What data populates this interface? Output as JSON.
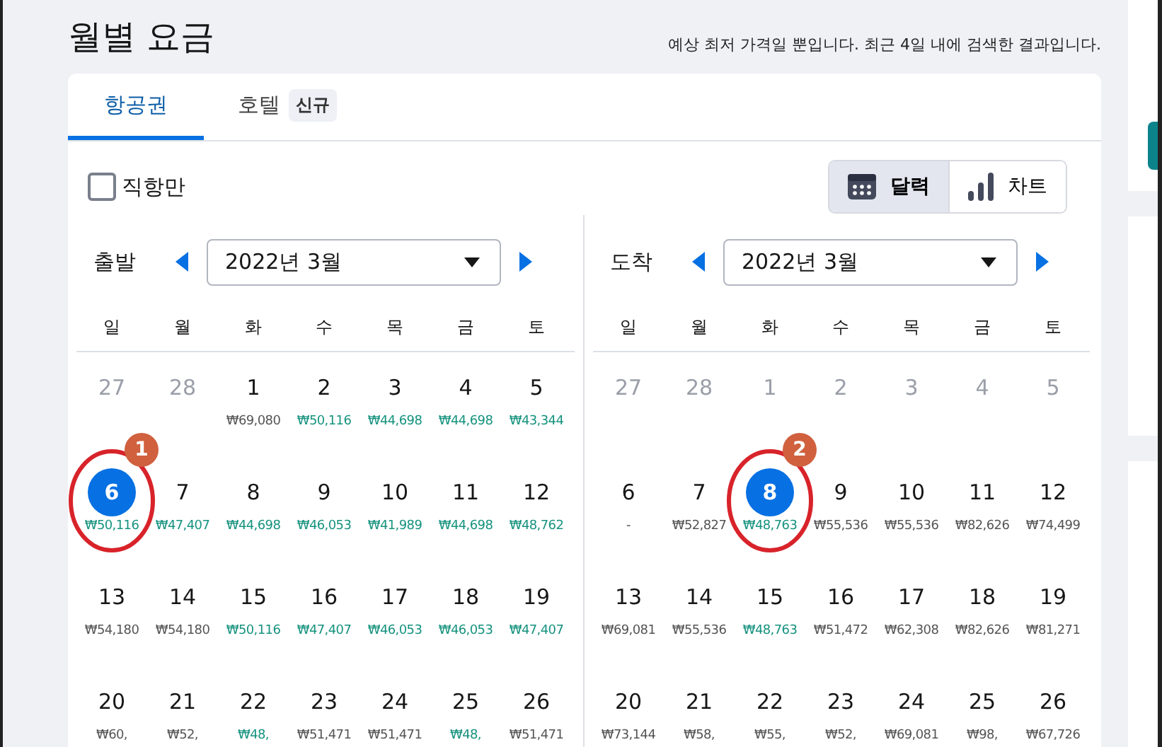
{
  "title": "월별 요금",
  "note": "예상 최저 가격일 뿐입니다. 최근 4일 내에 검색한 결과입니다.",
  "tabs": [
    {
      "label": "항공권",
      "selected": true
    },
    {
      "label": "호텔",
      "badge": "신규",
      "selected": false
    }
  ],
  "direct_only": {
    "label": "직항만",
    "checked": false
  },
  "view_toggle": [
    {
      "label": "달력",
      "kind": "calendar",
      "selected": true
    },
    {
      "label": "차트",
      "kind": "chart",
      "selected": false
    }
  ],
  "calendars": [
    {
      "label": "출발",
      "month": "2022년 3월",
      "weekdays": [
        "일",
        "월",
        "화",
        "수",
        "목",
        "금",
        "토"
      ],
      "weeks": [
        [
          {
            "day": "27",
            "disabled": true,
            "selected": false
          },
          {
            "day": "28",
            "disabled": true,
            "selected": false
          },
          {
            "day": "1",
            "price": "₩69,080",
            "cheap": false,
            "disabled": false,
            "selected": false
          },
          {
            "day": "2",
            "price": "₩50,116",
            "cheap": true,
            "disabled": false,
            "selected": false
          },
          {
            "day": "3",
            "price": "₩44,698",
            "cheap": true,
            "disabled": false,
            "selected": false
          },
          {
            "day": "4",
            "price": "₩44,698",
            "cheap": true,
            "disabled": false,
            "selected": false
          },
          {
            "day": "5",
            "price": "₩43,344",
            "cheap": true,
            "disabled": false,
            "selected": false
          }
        ],
        [
          {
            "day": "6",
            "price": "₩50,116",
            "cheap": true,
            "disabled": false,
            "selected": true,
            "annotation": "1"
          },
          {
            "day": "7",
            "price": "₩47,407",
            "cheap": true,
            "disabled": false,
            "selected": false
          },
          {
            "day": "8",
            "price": "₩44,698",
            "cheap": true,
            "disabled": false,
            "selected": false
          },
          {
            "day": "9",
            "price": "₩46,053",
            "cheap": true,
            "disabled": false,
            "selected": false
          },
          {
            "day": "10",
            "price": "₩41,989",
            "cheap": true,
            "disabled": false,
            "selected": false
          },
          {
            "day": "11",
            "price": "₩44,698",
            "cheap": true,
            "disabled": false,
            "selected": false
          },
          {
            "day": "12",
            "price": "₩48,762",
            "cheap": true,
            "disabled": false,
            "selected": false
          }
        ],
        [
          {
            "day": "13",
            "price": "₩54,180",
            "cheap": false,
            "disabled": false,
            "selected": false
          },
          {
            "day": "14",
            "price": "₩54,180",
            "cheap": false,
            "disabled": false,
            "selected": false
          },
          {
            "day": "15",
            "price": "₩50,116",
            "cheap": true,
            "disabled": false,
            "selected": false
          },
          {
            "day": "16",
            "price": "₩47,407",
            "cheap": true,
            "disabled": false,
            "selected": false
          },
          {
            "day": "17",
            "price": "₩46,053",
            "cheap": true,
            "disabled": false,
            "selected": false
          },
          {
            "day": "18",
            "price": "₩46,053",
            "cheap": true,
            "disabled": false,
            "selected": false
          },
          {
            "day": "19",
            "price": "₩47,407",
            "cheap": true,
            "disabled": false,
            "selected": false
          }
        ],
        [
          {
            "day": "20",
            "price": "₩60,",
            "cheap": false,
            "disabled": false,
            "selected": false
          },
          {
            "day": "21",
            "price": "₩52,",
            "cheap": false,
            "disabled": false,
            "selected": false
          },
          {
            "day": "22",
            "price": "₩48,",
            "cheap": true,
            "disabled": false,
            "selected": false
          },
          {
            "day": "23",
            "price": "₩51,471",
            "cheap": false,
            "disabled": false,
            "selected": false
          },
          {
            "day": "24",
            "price": "₩51,471",
            "cheap": false,
            "disabled": false,
            "selected": false
          },
          {
            "day": "25",
            "price": "₩48,",
            "cheap": true,
            "disabled": false,
            "selected": false
          },
          {
            "day": "26",
            "price": "₩51,471",
            "cheap": false,
            "disabled": false,
            "selected": false
          }
        ]
      ]
    },
    {
      "label": "도착",
      "month": "2022년 3월",
      "weekdays": [
        "일",
        "월",
        "화",
        "수",
        "목",
        "금",
        "토"
      ],
      "weeks": [
        [
          {
            "day": "27",
            "disabled": true,
            "selected": false
          },
          {
            "day": "28",
            "disabled": true,
            "selected": false
          },
          {
            "day": "1",
            "disabled": true,
            "selected": false
          },
          {
            "day": "2",
            "disabled": true,
            "selected": false
          },
          {
            "day": "3",
            "disabled": true,
            "selected": false
          },
          {
            "day": "4",
            "disabled": true,
            "selected": false
          },
          {
            "day": "5",
            "disabled": true,
            "selected": false
          }
        ],
        [
          {
            "day": "6",
            "price": "-",
            "cheap": false,
            "disabled": false,
            "selected": false
          },
          {
            "day": "7",
            "price": "₩52,827",
            "cheap": false,
            "disabled": false,
            "selected": false
          },
          {
            "day": "8",
            "price": "₩48,763",
            "cheap": true,
            "disabled": false,
            "selected": true,
            "annotation": "2"
          },
          {
            "day": "9",
            "price": "₩55,536",
            "cheap": false,
            "disabled": false,
            "selected": false
          },
          {
            "day": "10",
            "price": "₩55,536",
            "cheap": false,
            "disabled": false,
            "selected": false
          },
          {
            "day": "11",
            "price": "₩82,626",
            "cheap": false,
            "disabled": false,
            "selected": false
          },
          {
            "day": "12",
            "price": "₩74,499",
            "cheap": false,
            "disabled": false,
            "selected": false
          }
        ],
        [
          {
            "day": "13",
            "price": "₩69,081",
            "cheap": false,
            "disabled": false,
            "selected": false
          },
          {
            "day": "14",
            "price": "₩55,536",
            "cheap": false,
            "disabled": false,
            "selected": false
          },
          {
            "day": "15",
            "price": "₩48,763",
            "cheap": true,
            "disabled": false,
            "selected": false
          },
          {
            "day": "16",
            "price": "₩51,472",
            "cheap": false,
            "disabled": false,
            "selected": false
          },
          {
            "day": "17",
            "price": "₩62,308",
            "cheap": false,
            "disabled": false,
            "selected": false
          },
          {
            "day": "18",
            "price": "₩82,626",
            "cheap": false,
            "disabled": false,
            "selected": false
          },
          {
            "day": "19",
            "price": "₩81,271",
            "cheap": false,
            "disabled": false,
            "selected": false
          }
        ],
        [
          {
            "day": "20",
            "price": "₩73,144",
            "cheap": false,
            "disabled": false,
            "selected": false
          },
          {
            "day": "21",
            "price": "₩58,",
            "cheap": false,
            "disabled": false,
            "selected": false
          },
          {
            "day": "22",
            "price": "₩55,",
            "cheap": false,
            "disabled": false,
            "selected": false
          },
          {
            "day": "23",
            "price": "₩52,",
            "cheap": false,
            "disabled": false,
            "selected": false
          },
          {
            "day": "24",
            "price": "₩69,081",
            "cheap": false,
            "disabled": false,
            "selected": false
          },
          {
            "day": "25",
            "price": "₩98,",
            "cheap": false,
            "disabled": false,
            "selected": false
          },
          {
            "day": "26",
            "price": "₩67,726",
            "cheap": false,
            "disabled": false,
            "selected": false
          }
        ]
      ]
    }
  ]
}
